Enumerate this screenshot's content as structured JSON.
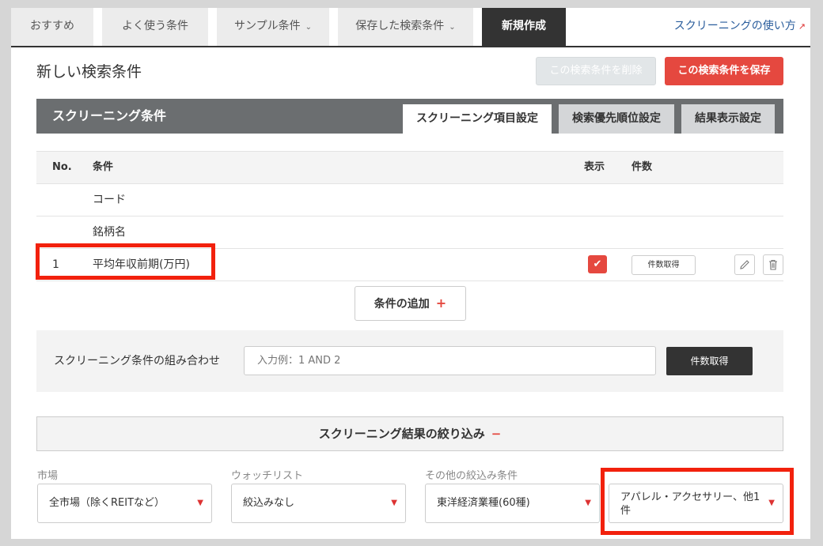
{
  "top_tabs": [
    {
      "label": "おすすめ"
    },
    {
      "label": "よく使う条件"
    },
    {
      "label": "サンプル条件"
    },
    {
      "label": "保存した検索条件"
    },
    {
      "label": "新規作成"
    }
  ],
  "help_link": "スクリーニングの使い方",
  "page_title": "新しい検索条件",
  "buttons": {
    "delete": "この検索条件を削除",
    "save": "この検索条件を保存",
    "add_condition": "条件の追加",
    "get_count": "件数取得",
    "get_count_small": "件数取得"
  },
  "screening": {
    "title": "スクリーニング条件",
    "tabs": [
      "スクリーニング項目設定",
      "検索優先順位設定",
      "結果表示設定"
    ]
  },
  "table": {
    "headers": {
      "no": "No.",
      "name": "条件",
      "show": "表示",
      "count": "件数"
    },
    "rows": [
      {
        "no": "",
        "name": "コード"
      },
      {
        "no": "",
        "name": "銘柄名"
      },
      {
        "no": "1",
        "name": "平均年収前期(万円)"
      }
    ]
  },
  "combination": {
    "label": "スクリーニング条件の組み合わせ",
    "placeholder": "入力例：1 AND 2"
  },
  "filter": {
    "title": "スクリーニング結果の絞り込み",
    "fields": [
      {
        "label": "市場",
        "value": "全市場（除くREITなど）"
      },
      {
        "label": "ウォッチリスト",
        "value": "絞込みなし"
      },
      {
        "label": "その他の絞込み条件",
        "value": "東洋経済業種(60種)"
      },
      {
        "label": "",
        "value": "アパレル・アクセサリー、他1件"
      }
    ]
  },
  "colors": {
    "accent": "#e5483f",
    "dark": "#333333",
    "link": "#2a5d9c",
    "highlight": "#f2210d"
  }
}
